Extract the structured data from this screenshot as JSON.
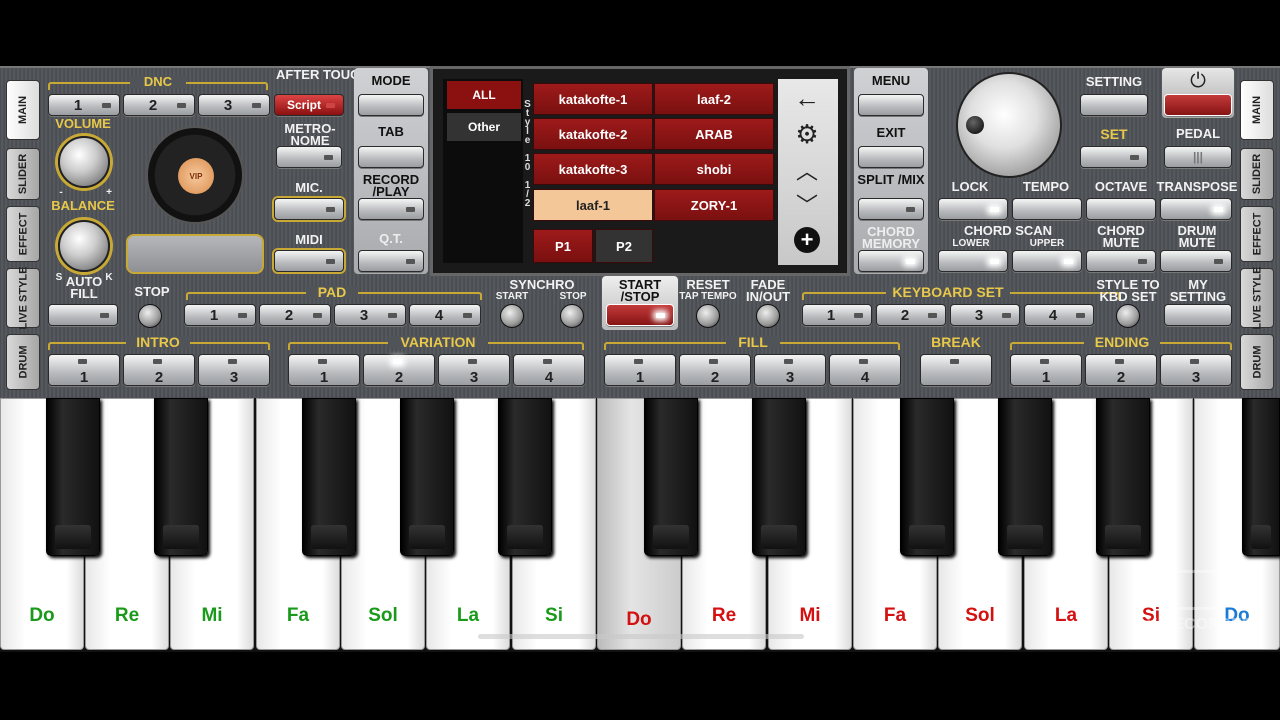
{
  "colors": {
    "accent_gold": "#c9a935",
    "red": "#8b1010",
    "note_green": "#1a9a1a",
    "note_red": "#d41010",
    "note_blue": "#1a7bd4"
  },
  "side_tabs_left": [
    "MAIN",
    "SLIDER",
    "EFFECT",
    "LIVE STYLE",
    "DRUM"
  ],
  "side_tabs_right": [
    "MAIN",
    "SLIDER",
    "EFFECT",
    "LIVE STYLE",
    "DRUM"
  ],
  "dnc": {
    "label": "DNC",
    "buttons": [
      "1",
      "2",
      "3"
    ],
    "script": "Script"
  },
  "after_touch": "AFTER TOUCH",
  "metronome": "METRO-NOME",
  "mic": "MIC.",
  "midi": "MIDI",
  "volume": "VOLUME",
  "balance": "BALANCE",
  "balance_minus": "-",
  "balance_plus": "+",
  "auto_fill": "AUTO FILL",
  "knob_s": "S",
  "knob_k": "K",
  "vip_badge": "VIP",
  "mode": {
    "mode": "MODE",
    "tab": "TAB",
    "record_play": "RECORD /PLAY",
    "qt": "Q.T."
  },
  "right_mode": {
    "menu": "MENU",
    "exit": "EXIT",
    "split_mix": "SPLIT /MIX",
    "chord_memory": "CHORD MEMORY"
  },
  "screen": {
    "categories": [
      "ALL",
      "Other"
    ],
    "style_label": "Style 10 1/2",
    "styles": [
      "katakofte-1",
      "laaf-2",
      "katakofte-2",
      "ARAB",
      "katakofte-3",
      "shobi",
      "laaf-1",
      "ZORY-1"
    ],
    "selected": "laaf-1",
    "pages": [
      "P1",
      "P2"
    ]
  },
  "setting": "SETTING",
  "set": "SET",
  "pedal": "PEDAL",
  "lock": "LOCK",
  "tempo": "TEMPO",
  "octave": "OCTAVE",
  "transpose": "TRANSPOSE",
  "chord_scan": "CHORD SCAN",
  "lower": "LOWER",
  "upper": "UPPER",
  "chord_mute": "CHORD MUTE",
  "drum_mute": "DRUM MUTE",
  "stop": "STOP",
  "pad": {
    "label": "PAD",
    "buttons": [
      "1",
      "2",
      "3",
      "4"
    ]
  },
  "synchro": "SYNCHRO",
  "synchro_start": "START",
  "synchro_stop": "STOP",
  "start_stop": "START /STOP",
  "reset": "RESET",
  "tap_tempo": "TAP TEMPO",
  "fade": "FADE IN/OUT",
  "keyboard_set": {
    "label": "KEYBOARD SET",
    "buttons": [
      "1",
      "2",
      "3",
      "4"
    ]
  },
  "style_to_kbd": "STYLE TO KBD SET",
  "my_setting": "MY SETTING",
  "intro": {
    "label": "INTRO",
    "buttons": [
      "1",
      "2",
      "3"
    ]
  },
  "variation": {
    "label": "VARIATION",
    "buttons": [
      "1",
      "2",
      "3",
      "4"
    ]
  },
  "fill": {
    "label": "FILL",
    "buttons": [
      "1",
      "2",
      "3",
      "4"
    ]
  },
  "break": "BREAK",
  "ending": {
    "label": "ENDING",
    "buttons": [
      "1",
      "2",
      "3"
    ]
  },
  "keys": [
    "Do",
    "Re",
    "Mi",
    "Fa",
    "Sol",
    "La",
    "Si",
    "Do",
    "Re",
    "Mi",
    "Fa",
    "Sol",
    "La",
    "Si",
    "Do"
  ],
  "watermark": "V RECORDER"
}
